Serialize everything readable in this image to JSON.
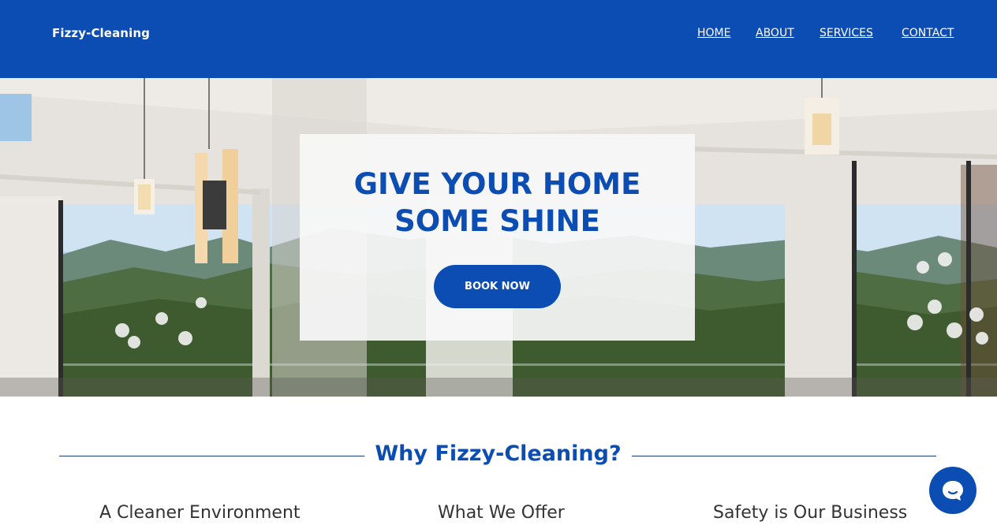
{
  "header": {
    "brand": "Fizzy-Cleaning",
    "nav": [
      "HOME",
      "ABOUT",
      "SERVICES",
      "CONTACT"
    ]
  },
  "hero": {
    "title_line1": "GIVE YOUR HOME",
    "title_line2": "SOME SHINE",
    "cta_label": "BOOK NOW"
  },
  "why": {
    "title": "Why Fizzy-Cleaning?",
    "features": [
      "A Cleaner Environment",
      "What We Offer",
      "Safety is Our Business"
    ]
  },
  "colors": {
    "brand_blue": "#0b4db3",
    "heading_text": "#333333"
  },
  "icons": {
    "chat": "chat-bubble-icon"
  }
}
